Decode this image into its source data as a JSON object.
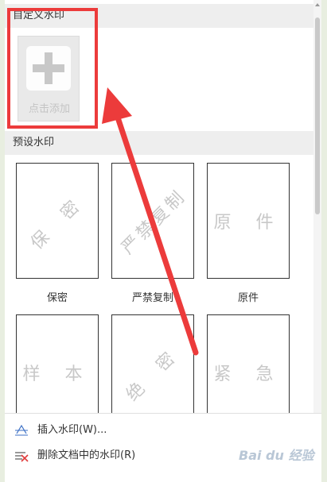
{
  "custom": {
    "header": "自定义水印",
    "add_label": "点击添加"
  },
  "preset": {
    "header": "预设水印",
    "items": [
      {
        "label": "保密",
        "watermark": "保 密"
      },
      {
        "label": "严禁复制",
        "watermark": "严禁复制"
      },
      {
        "label": "原件",
        "watermark": "原 件"
      },
      {
        "label": "",
        "watermark": "样 本"
      },
      {
        "label": "",
        "watermark": "绝 密"
      },
      {
        "label": "",
        "watermark": "紧 急"
      }
    ]
  },
  "menu": {
    "insert_label": "插入水印(W)...",
    "remove_label": "删除文档中的水印(R)"
  },
  "brand": "Bai du 经验",
  "colors": {
    "highlight": "#ec3b3b",
    "watermark_text": "#c8c8c8"
  }
}
